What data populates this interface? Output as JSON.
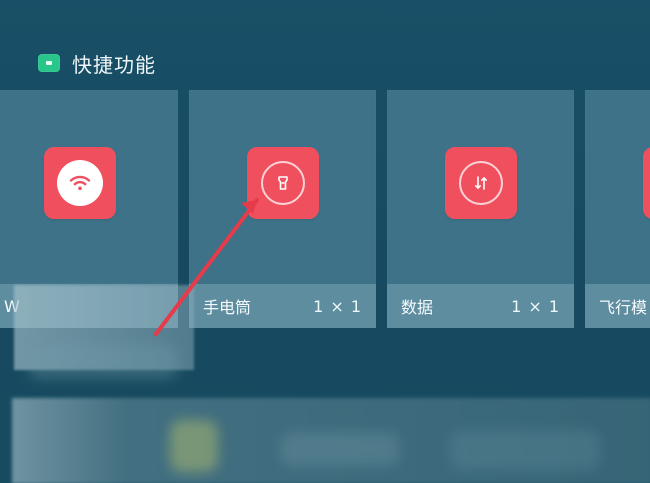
{
  "section": {
    "title": "快捷功能",
    "icon": "shortcut-panel-icon"
  },
  "tiles": [
    {
      "name": "",
      "label": "W",
      "size": "",
      "icon": "wifi-icon"
    },
    {
      "name": "flashlight",
      "label": "手电筒",
      "size": "1 × 1",
      "icon": "flashlight-icon"
    },
    {
      "name": "data",
      "label": "数据",
      "size": "1 × 1",
      "icon": "data-transfer-icon"
    },
    {
      "name": "airplane",
      "label": "飞行模",
      "size": "",
      "icon": "airplane-mode-icon"
    }
  ],
  "colors": {
    "background": "#184b61",
    "tile": "#3d7288",
    "tile_label": "#5f8da0",
    "accent_red": "#f04f5e",
    "header_icon": "#28c68a",
    "annotation_arrow": "#e53b4a"
  }
}
